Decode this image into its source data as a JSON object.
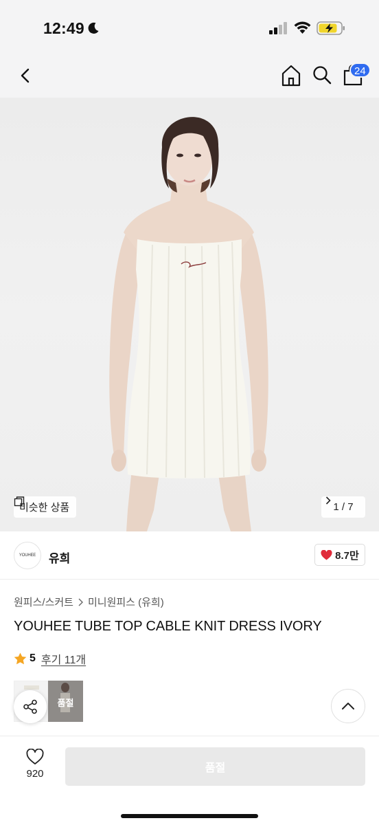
{
  "status_bar": {
    "time": "12:49",
    "icons": [
      "moon-icon",
      "signal-icon",
      "wifi-icon",
      "battery-charging-icon"
    ]
  },
  "nav": {
    "icons": [
      "back-icon",
      "home-icon",
      "search-icon",
      "shopping-bag-icon"
    ],
    "bag_badge": "24",
    "badge_color": "#2f6bf0"
  },
  "gallery": {
    "similar_label": "비슷한 상품",
    "pager": "1 / 7"
  },
  "brand": {
    "logo_text": "YOUHEE",
    "name": "유희",
    "likes": "8.7만",
    "heart_color": "#e02b3a"
  },
  "product": {
    "breadcrumb": [
      "원피스/스커트",
      "미니원피스 (유희)"
    ],
    "title": "YOUHEE TUBE TOP CABLE KNIT DRESS IVORY",
    "rating_score": "5",
    "reviews": "후기 11개",
    "star_color": "#f5a623",
    "thumb_soldout_label": "품절"
  },
  "bottom_bar": {
    "wish_count": "920",
    "action_label": "품절"
  }
}
